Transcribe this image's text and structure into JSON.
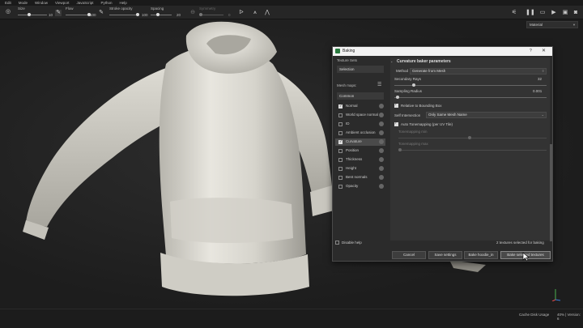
{
  "menu": [
    "Edit",
    "Mode",
    "Window",
    "Viewport",
    "JavaScript",
    "Python",
    "Help"
  ],
  "toolbar": {
    "size_label": "Size",
    "size_value": "10",
    "flow_label": "Flow",
    "flow_value": "100",
    "stroke_opacity_label": "Stroke opacity",
    "stroke_opacity_value": "100",
    "spacing_label": "Spacing",
    "spacing_value": "20",
    "symmetry_label": "Symmetry",
    "symmetry_value": "0"
  },
  "material_select": "Material",
  "dialog": {
    "title": "Baking",
    "help": "?",
    "close": "✕",
    "texture_sets_label": "Texture Sets",
    "texture_sets_value": "Selection",
    "mesh_maps_label": "Mesh maps:",
    "common_label": "Common",
    "mesh_maps": [
      {
        "label": "Normal",
        "checked": true
      },
      {
        "label": "World space normal",
        "checked": false
      },
      {
        "label": "ID",
        "checked": false
      },
      {
        "label": "Ambient occlusion",
        "checked": false
      },
      {
        "label": "Curvature",
        "checked": true
      },
      {
        "label": "Position",
        "checked": false
      },
      {
        "label": "Thickness",
        "checked": false
      },
      {
        "label": "Height",
        "checked": false
      },
      {
        "label": "Bent normals",
        "checked": false
      },
      {
        "label": "Opacity",
        "checked": false
      }
    ],
    "section_header": "Curvature baker parameters",
    "method_label": "Method",
    "method_value": "Generate from Mesh",
    "secondary_rays_label": "Secondary Rays",
    "secondary_rays_value": "32",
    "sampling_radius_label": "Sampling Radius",
    "sampling_radius_value": "0.001",
    "relative_bbox_label": "Relative to Bounding Box",
    "self_intersection_label": "Self Intersection",
    "self_intersection_value": "Only Same Mesh Name",
    "auto_tonemap_label": "Auto Tonemapping (per UV Tile)",
    "tonemap_min_label": "Tonemapping min",
    "tonemap_max_label": "Tonemapping max",
    "disable_help_label": "Disable help",
    "status": "2 textures selected for baking",
    "buttons": {
      "cancel": "Cancel",
      "save_settings": "Save settings",
      "bake_hoodie": "Bake hoodie_in",
      "bake_selected": "Bake selected textures"
    }
  },
  "statusbar": {
    "cache": "Cache Disk Usage",
    "version": "40% | Version: 6"
  }
}
